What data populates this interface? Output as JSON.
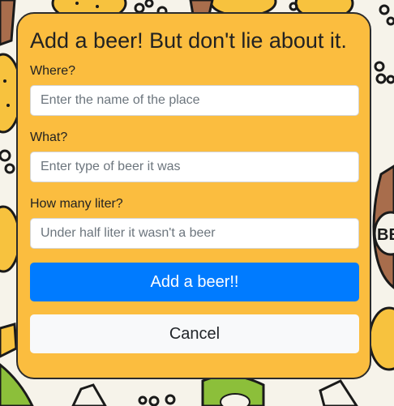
{
  "modal": {
    "title": "Add a beer! But don't lie about it.",
    "where_label": "Where?",
    "where_placeholder": "Enter the name of the place",
    "what_label": "What?",
    "what_placeholder": "Enter type of beer it was",
    "liter_label": "How many liter?",
    "liter_placeholder": "Under half liter it wasn't a beer",
    "submit_label": "Add a beer!!",
    "cancel_label": "Cancel"
  },
  "background": {
    "badge_text": "BEER",
    "colors": {
      "pretzel": "#f7c23e",
      "bottle": "#a86d4c",
      "leaf": "#8cbf3a",
      "outline": "#1a1a1a"
    }
  },
  "colors": {
    "modal_bg": "#fbbd3f",
    "primary": "#007bff",
    "light": "#f8f9fa"
  }
}
